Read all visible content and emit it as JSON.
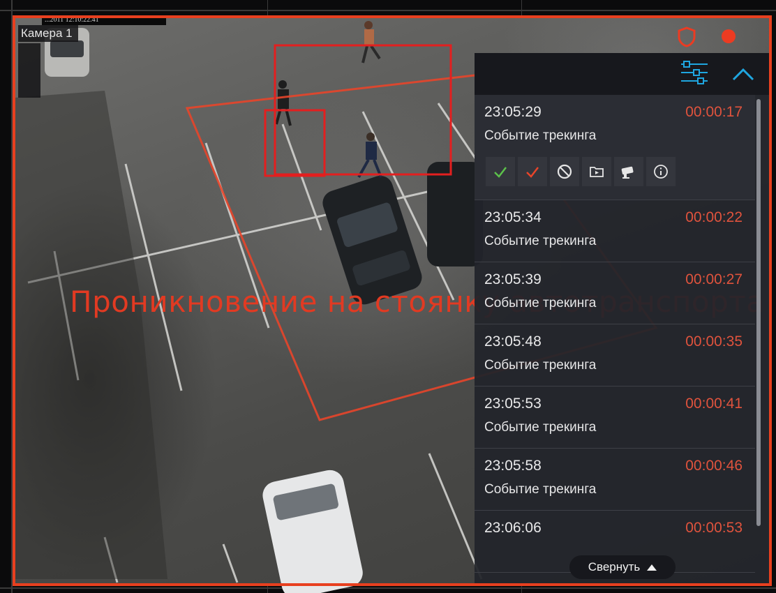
{
  "camera": {
    "name": "Камера 1",
    "osd_timestamp": "...2011 12:10:22.41"
  },
  "zone": {
    "label": "Проникновение на стоянку автотранспорта"
  },
  "colors": {
    "alarm": "#e8401f",
    "offset_text": "#e0533d",
    "accent": "#1fa6e0",
    "panel_bg": "#22242a"
  },
  "panel": {
    "filter_icon": "sliders-icon",
    "collapse_icon": "chevron-up-icon",
    "events": [
      {
        "time": "23:05:29",
        "offset": "00:00:17",
        "type": "Событие трекинга",
        "expanded": true
      },
      {
        "time": "23:05:34",
        "offset": "00:00:22",
        "type": "Событие трекинга"
      },
      {
        "time": "23:05:39",
        "offset": "00:00:27",
        "type": "Событие трекинга"
      },
      {
        "time": "23:05:48",
        "offset": "00:00:35",
        "type": "Событие трекинга"
      },
      {
        "time": "23:05:53",
        "offset": "00:00:41",
        "type": "Событие трекинга"
      },
      {
        "time": "23:05:58",
        "offset": "00:00:46",
        "type": "Событие трекинга"
      },
      {
        "time": "23:06:06",
        "offset": "00:00:53",
        "type": ""
      }
    ],
    "actions": [
      "confirm-green-icon",
      "confirm-red-icon",
      "ignore-icon",
      "archive-icon",
      "camera-icon",
      "info-icon"
    ]
  },
  "collapse_button": {
    "label": "Свернуть"
  }
}
